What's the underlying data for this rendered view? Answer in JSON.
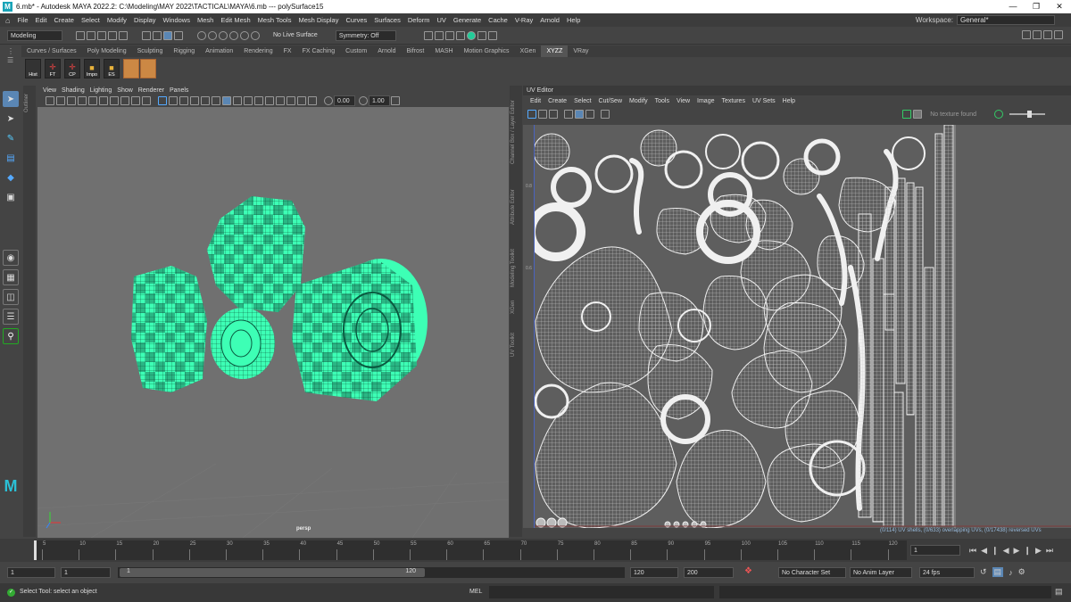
{
  "title": "6.mb* - Autodesk MAYA 2022.2: C:\\Modeling\\MAY 2022\\TACTICAL\\MAYA\\6.mb  ---  polySurface15",
  "menus": [
    "File",
    "Edit",
    "Create",
    "Select",
    "Modify",
    "Display",
    "Windows",
    "Mesh",
    "Edit Mesh",
    "Mesh Tools",
    "Mesh Display",
    "Curves",
    "Surfaces",
    "Deform",
    "UV",
    "Generate",
    "Cache",
    "V-Ray",
    "Arnold",
    "Help"
  ],
  "workspace": {
    "label": "Workspace:",
    "value": "General*"
  },
  "status": {
    "mode": "Modeling",
    "live": "No Live Surface",
    "symmetry": "Symmetry: Off"
  },
  "shelf_tabs": [
    "Curves / Surfaces",
    "Poly Modeling",
    "Sculpting",
    "Rigging",
    "Animation",
    "Rendering",
    "FX",
    "FX Caching",
    "Custom",
    "Arnold",
    "Bifrost",
    "MASH",
    "Motion Graphics",
    "XGen",
    "XYZZ",
    "VRay"
  ],
  "shelf_tab_selected": "XYZZ",
  "shelf_buttons": [
    "Hist",
    "FT",
    "CP",
    "Impo",
    "ES"
  ],
  "viewport": {
    "menus": [
      "View",
      "Shading",
      "Lighting",
      "Show",
      "Renderer",
      "Panels"
    ],
    "field1": "0.00",
    "field2": "1.00",
    "camera": "persp"
  },
  "side_tabs": [
    "Channel Box / Layer Editor",
    "Attribute Editor",
    "Modeling Toolkit",
    "XGen",
    "UV Toolkit"
  ],
  "outliner_tab": "Outliner",
  "uv_editor": {
    "title": "UV Editor",
    "menus": [
      "Edit",
      "Create",
      "Select",
      "Cut/Sew",
      "Modify",
      "Tools",
      "View",
      "Image",
      "Textures",
      "UV Sets",
      "Help"
    ],
    "texture": "No texture found",
    "status": "(0/114) UV shells, (0/633) overlapping UVs, (0/17438) reversed UVs",
    "ticks": [
      "0.8",
      "0.6"
    ]
  },
  "timeline": {
    "ticks": [
      "5",
      "10",
      "15",
      "20",
      "25",
      "30",
      "35",
      "40",
      "45",
      "50",
      "55",
      "60",
      "65",
      "70",
      "75",
      "80",
      "85",
      "90",
      "95",
      "100",
      "105",
      "110",
      "115",
      "120"
    ],
    "current": "1"
  },
  "range": {
    "start": "1",
    "playstart": "1",
    "slider_start": "1",
    "slider_end": "120",
    "playend": "120",
    "end": "200",
    "character": "No Character Set",
    "anim_layer": "No Anim Layer",
    "fps": "24 fps"
  },
  "cmd": {
    "lang": "MEL",
    "help": "Select Tool: select an object"
  },
  "colors": {
    "accent": "#3dffb5",
    "uv": "#e8e8e8",
    "bg": "#444444"
  }
}
